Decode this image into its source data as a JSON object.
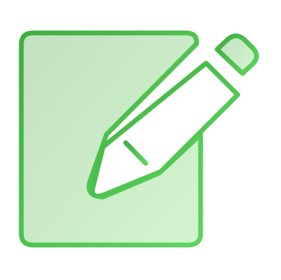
{
  "icon": {
    "name": "edit-icon",
    "parts": [
      "document-icon",
      "pencil-icon"
    ]
  },
  "colors": {
    "stroke_dark": "#3fae3f",
    "stroke_light": "#5fd45f",
    "fill_start": "#c3e0c0",
    "fill_end": "#d2f5cf",
    "background": "#ffffff"
  }
}
